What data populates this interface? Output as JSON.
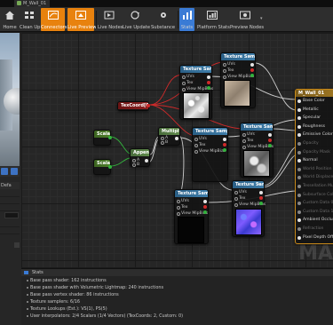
{
  "window": {
    "tab_title": "M_Wall_01"
  },
  "toolbar": {
    "buttons": [
      {
        "label": "Home",
        "icon": "home-icon"
      },
      {
        "label": "Clean Up",
        "icon": "cleanup-icon"
      },
      {
        "label": "Connectors",
        "icon": "connectors-icon",
        "active": true
      },
      {
        "label": "Live Preview",
        "icon": "live-preview-icon",
        "active": true
      },
      {
        "label": "Live Nodes",
        "icon": "live-nodes-icon"
      },
      {
        "label": "Live Update",
        "icon": "live-update-icon"
      },
      {
        "label": "Substance",
        "icon": "substance-icon"
      },
      {
        "label": "Stats",
        "icon": "stats-icon",
        "active": true
      },
      {
        "label": "Platform Stats",
        "icon": "platform-stats-icon"
      },
      {
        "label": "Preview Nodes",
        "icon": "preview-nodes-icon"
      }
    ]
  },
  "left_panel": {
    "details_label": "Defa"
  },
  "graph": {
    "watermark": "MA",
    "nodes": {
      "tex1": {
        "title": "Texture Sample",
        "pins": [
          "UVs",
          "Tex",
          "View MipBias"
        ]
      },
      "tex2": {
        "title": "Texture Sample",
        "pins": [
          "UVs",
          "Tex",
          "View MipBias"
        ]
      },
      "tex3": {
        "title": "Texture Sample",
        "pins": [
          "UVs",
          "Tex",
          "View MipBias"
        ]
      },
      "tex4": {
        "title": "Texture Sample",
        "pins": [
          "UVs",
          "Tex",
          "View MipBias"
        ]
      },
      "tex5": {
        "title": "Texture Sample",
        "pins": [
          "UVs",
          "Tex",
          "View MipBias"
        ]
      },
      "tex6": {
        "title": "Texture Sample",
        "pins": [
          "UVs",
          "Tex",
          "View MipBias"
        ]
      },
      "param": {
        "title": "TexCoord[0]"
      },
      "vec1": {
        "title": "Scalar"
      },
      "vec2": {
        "title": "Scalar"
      },
      "multiply": {
        "title": "Multiply",
        "pins": [
          "A",
          "B"
        ]
      },
      "append": {
        "title": "Append",
        "pins": [
          "A",
          "B"
        ]
      },
      "material": {
        "title": "M_Wall_01",
        "pins": [
          "Base Color",
          "Metallic",
          "Specular",
          "Roughness",
          "Emissive Color",
          "Opacity",
          "Opacity Mask",
          "Normal",
          "World Position Offset",
          "World Displacement",
          "Tessellation Multiplier",
          "Subsurface Color",
          "Custom Data 0",
          "Custom Data 1",
          "Ambient Occlusion",
          "Refraction",
          "Pixel Depth Offset"
        ]
      }
    }
  },
  "stats": {
    "header": "Stats",
    "lines": [
      "Base pass shader: 162 instructions",
      "Base pass shader with Volumetric Lightmap: 240 instructions",
      "Base pass vertex shader: 86 instructions",
      "Texture samplers: 6/16",
      "Texture Lookups (Est.): VS(1), PS(5)",
      "User interpolators: 2/4 Scalars (1/4 Vectors) (TexCoords: 2, Custom: 0)"
    ]
  }
}
